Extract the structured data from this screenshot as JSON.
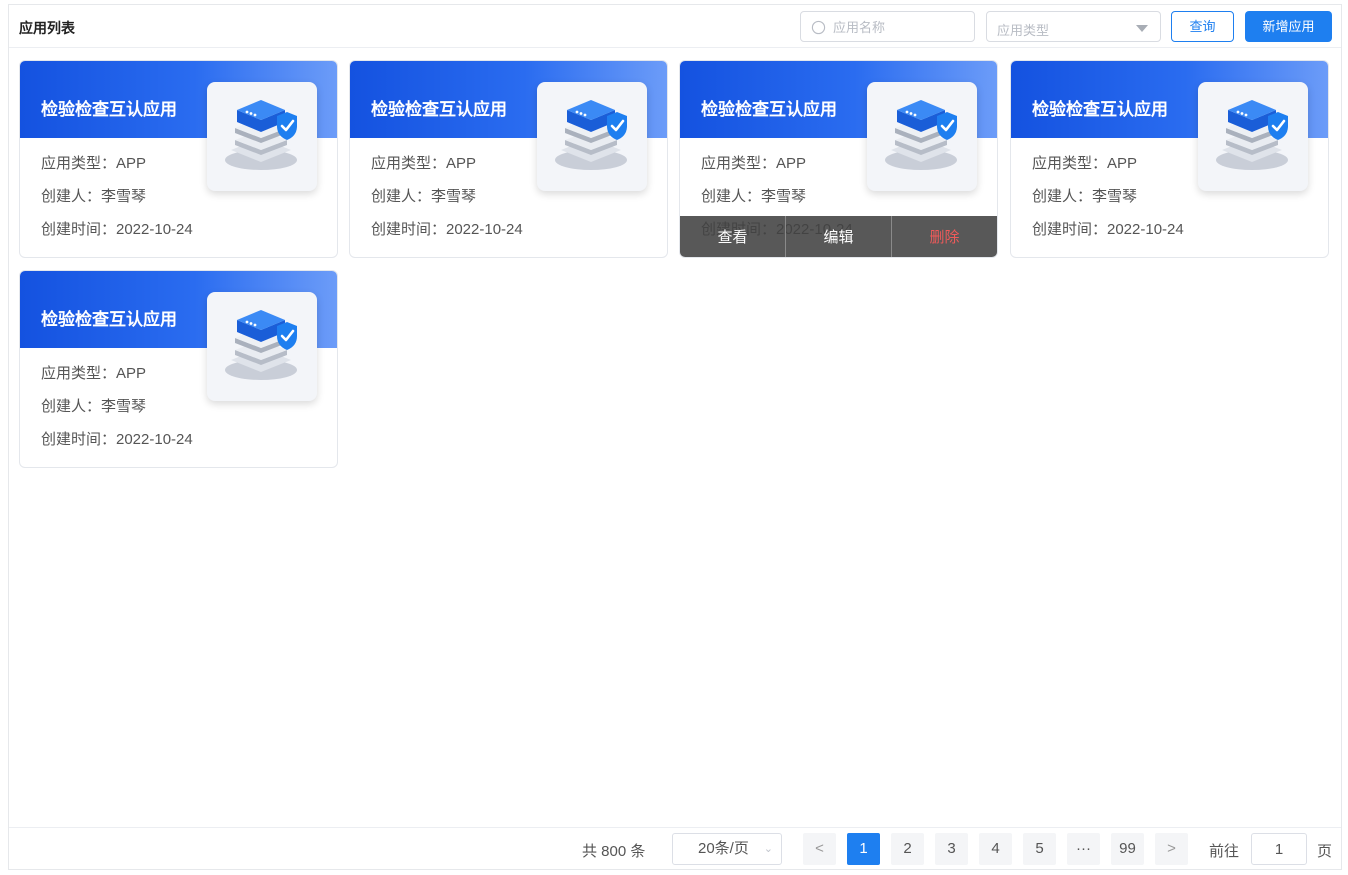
{
  "header": {
    "title": "应用列表",
    "search_placeholder": "应用名称",
    "type_placeholder": "应用类型",
    "query_label": "查询",
    "add_label": "新增应用"
  },
  "cards": [
    {
      "name": "检验检查互认应用",
      "type_line": "应用类型：APP",
      "creator_line": "创建人：李雪琴",
      "time_line": "创建时间：2022-10-24"
    },
    {
      "name": "检验检查互认应用",
      "type_line": "应用类型：APP",
      "creator_line": "创建人：李雪琴",
      "time_line": "创建时间：2022-10-24"
    },
    {
      "name": "检验检查互认应用",
      "type_line": "应用类型：APP",
      "creator_line": "创建人：李雪琴",
      "time_line": "创建时间：2022-10-24"
    },
    {
      "name": "检验检查互认应用",
      "type_line": "应用类型：APP",
      "creator_line": "创建人：李雪琴",
      "time_line": "创建时间：2022-10-24"
    },
    {
      "name": "检验检查互认应用",
      "type_line": "应用类型：APP",
      "creator_line": "创建人：李雪琴",
      "time_line": "创建时间：2022-10-24"
    }
  ],
  "card_actions": {
    "view": "查看",
    "edit": "编辑",
    "delete": "删除"
  },
  "colors": {
    "accent": "#1e7ff0",
    "danger": "#f05a5a"
  },
  "icons": {
    "card_thumb": "server-shield-icon",
    "search": "search-icon"
  },
  "pagination": {
    "total": "共 800 条",
    "page_size": "20条/页",
    "prev": "<",
    "pages": [
      "1",
      "2",
      "3",
      "4",
      "5",
      "···",
      "99"
    ],
    "current": "1",
    "next": ">",
    "goto_label": "前往",
    "goto_value": "1",
    "page_unit": "页"
  }
}
